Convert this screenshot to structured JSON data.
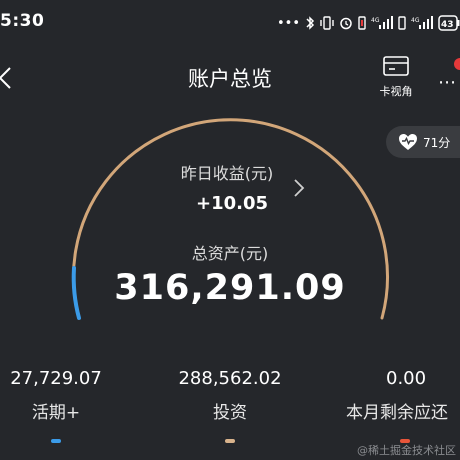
{
  "status_bar": {
    "time": "5:30",
    "network_badge": "4G",
    "network_badge_2": "4G",
    "battery_level": "43"
  },
  "nav": {
    "title": "账户总览",
    "card_view_label": "卡视角"
  },
  "score": {
    "value": "71分"
  },
  "gauge": {
    "yesterday_label": "昨日收益(元)",
    "yesterday_value": "+10.05",
    "total_label": "总资产(元)",
    "total_value": "316,291.09",
    "colors": {
      "track": "#d2a679",
      "highlight": "#3b9be8"
    }
  },
  "summary": [
    {
      "amount": "27,729.07",
      "label": "活期+",
      "indicator_color": "#3b9be8"
    },
    {
      "amount": "288,562.02",
      "label": "投资",
      "indicator_color": "#d9b38c"
    },
    {
      "amount": "0.00",
      "label": "本月剩余应还",
      "indicator_color": "#e8553a"
    }
  ],
  "watermark": "@稀土掘金技术社区"
}
